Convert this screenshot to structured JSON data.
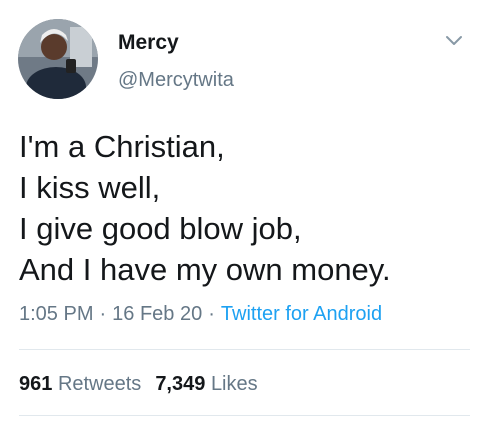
{
  "author": {
    "display_name": "Mercy",
    "handle": "@Mercytwita",
    "avatar_icon": "profile-photo"
  },
  "menu_icon": "chevron-down-icon",
  "tweet": {
    "lines": [
      "I'm a Christian,",
      "I kiss well,",
      "I give good blow job,",
      "And I have my own money."
    ]
  },
  "meta": {
    "time": "1:05 PM",
    "separator": "·",
    "date": "16 Feb 20",
    "source": "Twitter for Android"
  },
  "stats": {
    "retweets_count": "961",
    "retweets_label": "Retweets",
    "likes_count": "7,349",
    "likes_label": "Likes"
  },
  "colors": {
    "text": "#14171a",
    "secondary": "#657786",
    "link": "#1da1f2",
    "divider": "#e1e8ed"
  }
}
